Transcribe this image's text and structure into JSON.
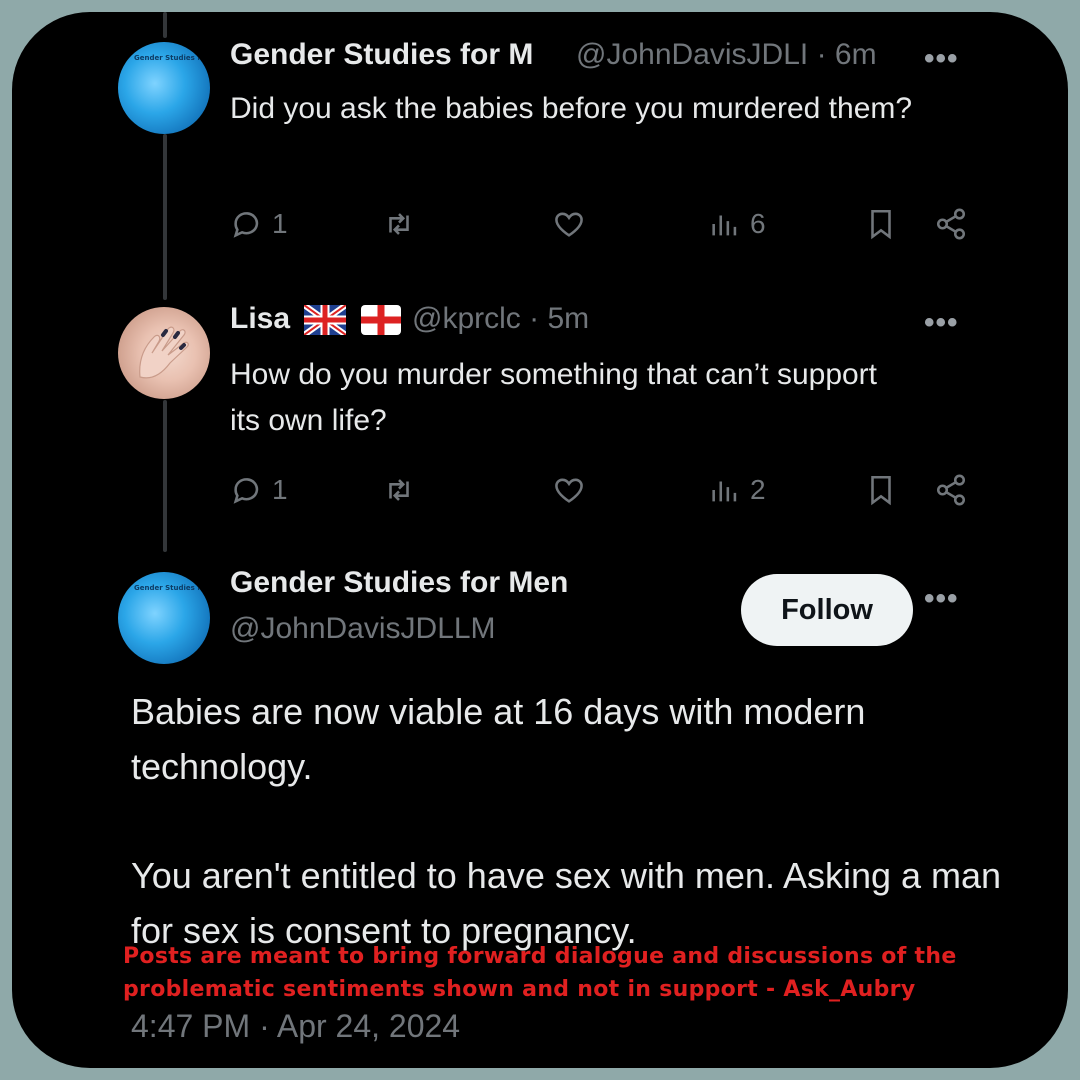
{
  "tweets": [
    {
      "name": "Gender Studies for M",
      "handle": "@JohnDavisJDLI",
      "time": "· 6m",
      "more": "•••",
      "text": "Did you ask the babies before you murdered them?",
      "replies": "1",
      "views": "6"
    },
    {
      "name": "Lisa",
      "flags": [
        "uk-flag-icon",
        "england-flag-icon"
      ],
      "handle": "@kprclc",
      "time": "· 5m",
      "more": "•••",
      "text": "How do you murder something that can’t support its own life?",
      "replies": "1",
      "views": "2"
    }
  ],
  "main": {
    "name": "Gender Studies for Men",
    "handle": "@JohnDavisJDLLM",
    "follow_label": "Follow",
    "more": "•••",
    "paragraph1": "Babies are now viable at 16 days with modern technology.",
    "paragraph2": "You aren't entitled to have sex with men.  Asking a man for sex is consent to pregnancy.",
    "timestamp": "4:47 PM · Apr 24, 2024"
  },
  "overlay": {
    "disclaimer": "Posts are meant to bring forward dialogue and discussions of the problematic sentiments shown and not in support - Ask_Aubry"
  },
  "avatar_text": "Gender Studies for Men",
  "colors": {
    "background": "#8fa9a9",
    "card": "#000000",
    "text": "#e7e9ea",
    "muted": "#71767b",
    "disclaimer": "#e02020"
  }
}
